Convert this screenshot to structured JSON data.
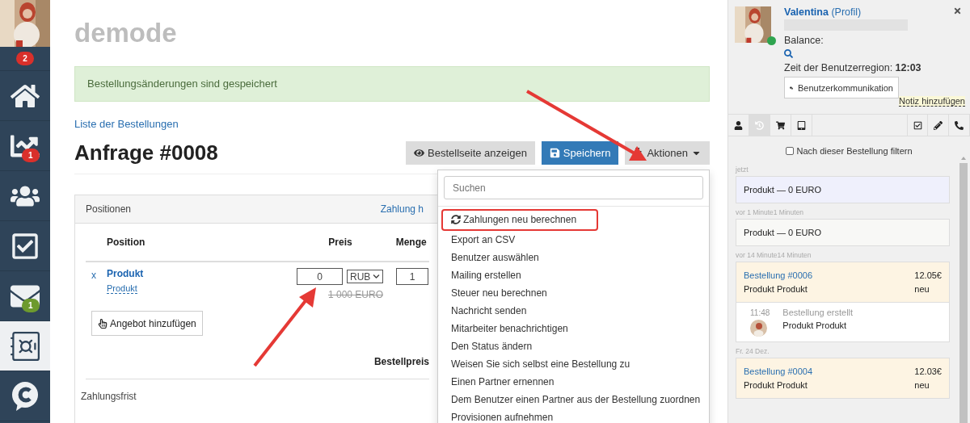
{
  "nav": {
    "top_badge": "2",
    "items": [
      {
        "kind": "home",
        "selected": false
      },
      {
        "kind": "chart",
        "selected": false,
        "badge": "1",
        "color": "#d9302b"
      },
      {
        "kind": "users",
        "selected": false
      },
      {
        "kind": "tasks",
        "selected": false
      },
      {
        "kind": "mail",
        "selected": false,
        "badge": "1",
        "color": "#6d9a2e"
      },
      {
        "kind": "safe",
        "selected": true
      },
      {
        "kind": "chat",
        "selected": false
      }
    ]
  },
  "main": {
    "brand": "demode",
    "alert": "Bestellungsänderungen sind gespeichert",
    "back_link": "Liste der Bestellungen",
    "title": "Anfrage #0008",
    "buttons": [
      {
        "kind": "view",
        "label": "Bestellseite anzeigen"
      },
      {
        "kind": "save",
        "label": "Speichern"
      },
      {
        "kind": "actions",
        "label": "Aktionen"
      }
    ],
    "panel": {
      "title": "Positionen",
      "link": "Zahlung h",
      "columns": [
        "Position",
        "Preis",
        "Menge"
      ],
      "rows": [
        {
          "remove": "x",
          "name": "Produkt",
          "subtitle": "Produkt",
          "price": "0",
          "currency": "RUB",
          "old_price": "1 000 EURO",
          "quantity": "1"
        }
      ],
      "add_button": "Angebot hinzufügen",
      "total_label": "Bestellpreis",
      "footer_label": "Zahlungsfrist"
    },
    "menu": {
      "search_placeholder": "Suchen",
      "items": [
        {
          "label": "Zahlungen neu berechnen",
          "kind": "refresh",
          "highlighted": true
        },
        {
          "label": "Export an CSV",
          "highlighted": false
        },
        {
          "label": "Benutzer auswählen",
          "highlighted": false
        },
        {
          "label": "Mailing erstellen",
          "highlighted": false
        },
        {
          "label": "Steuer neu berechnen",
          "highlighted": false
        },
        {
          "label": "Nachricht senden",
          "highlighted": false
        },
        {
          "label": "Mitarbeiter benachrichtigen",
          "highlighted": false
        },
        {
          "label": "Den Status ändern",
          "highlighted": false
        },
        {
          "label": "Weisen Sie sich selbst eine Bestellung zu",
          "highlighted": false
        },
        {
          "label": "Einen Partner ernennen",
          "highlighted": false
        },
        {
          "label": "Dem Benutzer einen Partner aus der Bestellung zuordnen",
          "highlighted": false
        },
        {
          "label": "Provisionen aufnehmen",
          "highlighted": false
        }
      ]
    }
  },
  "customer": {
    "name": "Valentina",
    "profile_link": "(Profil)",
    "online": true,
    "balance_label": "Balance:",
    "time_label": "Zeit der Benutzerregion:",
    "time": "12:03",
    "contact_button": "Benutzerkommunikation",
    "note_link": "Notiz hinzufügen",
    "tabs": [
      {
        "kind": "user",
        "selected": false
      },
      {
        "kind": "history",
        "selected": true
      },
      {
        "kind": "cart",
        "selected": false
      },
      {
        "kind": "tablet",
        "selected": false
      },
      {
        "kind": "checklist",
        "selected": false
      },
      {
        "kind": "pencil",
        "selected": false
      },
      {
        "kind": "phone",
        "selected": false
      }
    ],
    "filter": {
      "label": "Nach dieser Bestellung filtern",
      "checked": false
    },
    "feed": [
      {
        "time": "jetzt",
        "kind": "product",
        "color": "#eff0fc",
        "text": "Produkt — 0 EURO"
      },
      {
        "time": "vor 1 Minute1 Minuten",
        "kind": "product",
        "color": "#f8f8f6",
        "text": "Produkt — 0 EURO"
      },
      {
        "time": "vor 14 Minute14 Minuten",
        "kind": "order",
        "color": "#fdf4e3",
        "title": "Bestellung #0006",
        "amount": "12.05€",
        "subtitle": "Produkt Produkt",
        "status": "neu",
        "event": {
          "time": "11:48",
          "title": "Bestellung erstellt",
          "text": "Produkt Produkt"
        }
      },
      {
        "time": "Fr. 24 Dez.",
        "kind": "order",
        "color": "#fdf4e3",
        "title": "Bestellung #0004",
        "amount": "12.03€",
        "subtitle": "Produkt Produkt",
        "status": "neu"
      }
    ]
  }
}
